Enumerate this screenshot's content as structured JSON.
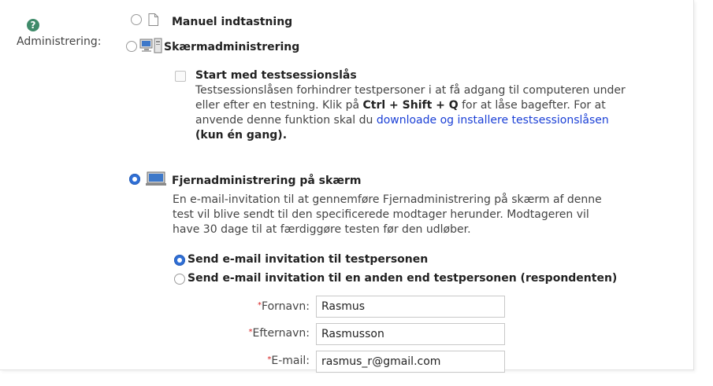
{
  "admin_label": "Administrering:",
  "options": {
    "manual": "Manuel indtastning",
    "screen": "Skærmadministrering",
    "remote": "Fjernadministrering på skærm"
  },
  "session_lock": {
    "title": "Start med testsessionslås",
    "desc_1": "Testsessionslåsen forhindrer testpersoner i at få adgang til computeren under",
    "desc_2_pre": "eller efter en testning. Klik på ",
    "desc_2_keys": "Ctrl + Shift + Q",
    "desc_2_post": " for at låse bagefter. For at",
    "desc_3_pre": "anvende denne funktion skal du ",
    "desc_3_link": "downloade og installere testsessionslåsen",
    "desc_4": "(kun én gang)."
  },
  "remote_desc": [
    "En e-mail-invitation til at gennemføre Fjernadministrering på skærm af denne",
    "test vil blive sendt til den specificerede modtager herunder. Modtageren vil",
    "have 30 dage til at færdiggøre testen før den udløber."
  ],
  "send_options": {
    "self": "Send e-mail invitation til testpersonen",
    "other": "Send e-mail invitation til en anden end testpersonen (respondenten)"
  },
  "fields": {
    "firstname_label": "Fornavn:",
    "firstname_value": "Rasmus",
    "lastname_label": "Efternavn:",
    "lastname_value": "Rasmusson",
    "email_label": "E-mail:",
    "email_value": "rasmus_r@gmail.com",
    "required_mark": "*"
  },
  "colors": {
    "accent": "#2f6fd6",
    "help": "#3f8b6a",
    "link": "#1a3fd6",
    "required": "#d62020"
  },
  "icons": [
    "help-icon",
    "document-icon",
    "computer-icon",
    "monitor-icon"
  ]
}
